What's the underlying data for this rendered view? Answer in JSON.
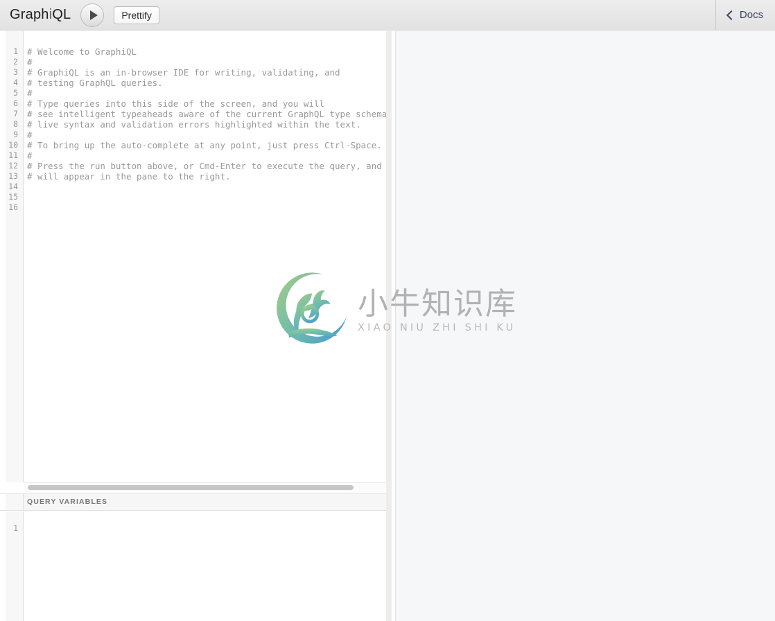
{
  "toolbar": {
    "app_title": "GraphiQL",
    "app_title_prefix": "Graph",
    "app_title_mid": "i",
    "app_title_suffix": "QL",
    "run_button_label": "",
    "run_icon": "play-icon",
    "prettify_label": "Prettify",
    "docs_label": "Docs",
    "docs_icon": "chevron-left-icon"
  },
  "query_editor": {
    "line_numbers": [
      "1",
      "2",
      "3",
      "4",
      "5",
      "6",
      "7",
      "8",
      "9",
      "10",
      "11",
      "12",
      "13",
      "14",
      "15",
      "16"
    ],
    "lines": [
      "# Welcome to GraphiQL",
      "#",
      "# GraphiQL is an in-browser IDE for writing, validating, and",
      "# testing GraphQL queries.",
      "#",
      "# Type queries into this side of the screen, and you will",
      "# see intelligent typeaheads aware of the current GraphQL type schema and",
      "# live syntax and validation errors highlighted within the text.",
      "#",
      "# To bring up the auto-complete at any point, just press Ctrl-Space.",
      "#",
      "# Press the run button above, or Cmd-Enter to execute the query, and the result",
      "# will appear in the pane to the right.",
      "",
      "",
      ""
    ]
  },
  "query_variables": {
    "header_label": "QUERY VARIABLES",
    "line_numbers": [
      "1"
    ],
    "lines": [
      ""
    ]
  },
  "result_pane": {
    "content": ""
  },
  "watermark": {
    "chinese": "小牛知识库",
    "pinyin": "XIAO NIU ZHI SHI KU",
    "gradient_top": "#8dc07a",
    "gradient_bottom": "#55a7c9"
  },
  "colors": {
    "toolbar_bg": "#e9e9e9",
    "editor_bg": "#ffffff",
    "result_bg": "#f6f7f8",
    "comment_text": "#999999",
    "gutter_text": "#999999",
    "docs_text": "#3b4666"
  }
}
